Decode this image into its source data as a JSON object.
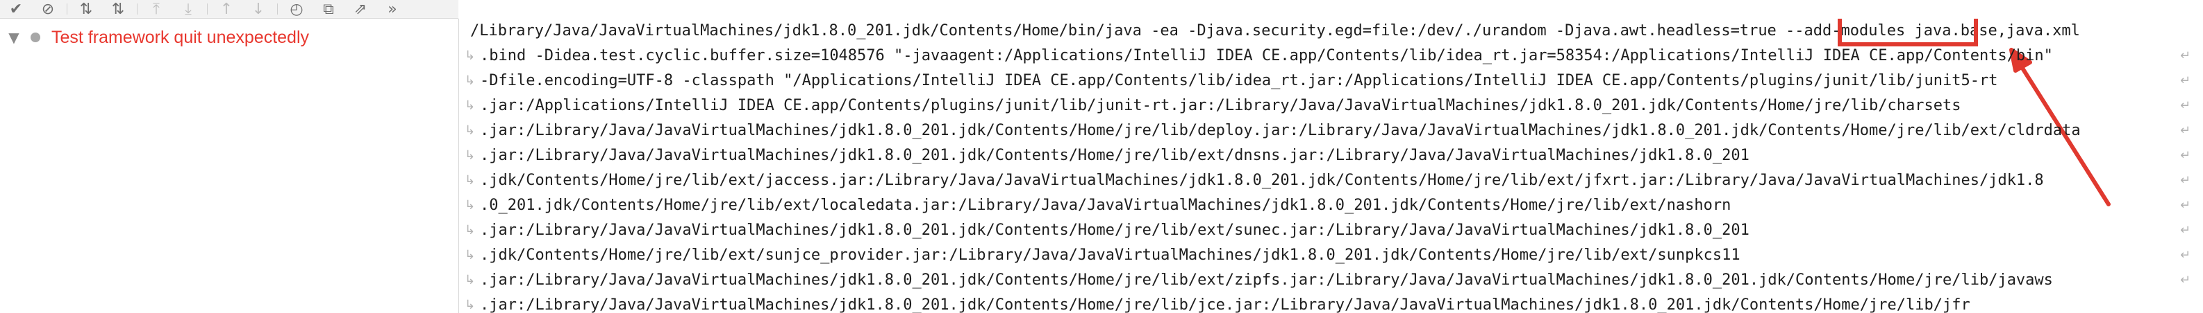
{
  "toolbar": {
    "buttons": [
      {
        "name": "check-icon",
        "glyph": "✔"
      },
      {
        "name": "stop-circle-icon",
        "glyph": "⊘"
      },
      {
        "name": "sort-alpha-icon",
        "glyph": "⇅"
      },
      {
        "name": "sort-duration-icon",
        "glyph": "⇅"
      },
      {
        "name": "import-icon",
        "glyph": "⤒"
      },
      {
        "name": "export-icon",
        "glyph": "⤓"
      },
      {
        "name": "up-arrow-icon",
        "glyph": "↑"
      },
      {
        "name": "down-arrow-icon",
        "glyph": "↓"
      },
      {
        "name": "history-icon",
        "glyph": "◴"
      },
      {
        "name": "open-tab-icon",
        "glyph": "⧉"
      },
      {
        "name": "external-link-icon",
        "glyph": "⇗"
      },
      {
        "name": "more-icon",
        "glyph": "»"
      }
    ]
  },
  "test_tree": {
    "expand_glyph": "▼",
    "item_label": "Test framework quit unexpectedly",
    "status_color": "#e8372e"
  },
  "console": {
    "lines": [
      "/Library/Java/JavaVirtualMachines/jdk1.8.0_201.jdk/Contents/Home/bin/java -ea -Djava.security.egd=file:/dev/./urandom -Djava.awt.headless=true --add-modules java.base,java.xml",
      ".bind -Didea.test.cyclic.buffer.size=1048576 \"-javaagent:/Applications/IntelliJ IDEA CE.app/Contents/lib/idea_rt.jar=58354:/Applications/IntelliJ IDEA CE.app/Contents/bin\"",
      "-Dfile.encoding=UTF-8 -classpath \"/Applications/IntelliJ IDEA CE.app/Contents/lib/idea_rt.jar:/Applications/IntelliJ IDEA CE.app/Contents/plugins/junit/lib/junit5-rt",
      ".jar:/Applications/IntelliJ IDEA CE.app/Contents/plugins/junit/lib/junit-rt.jar:/Library/Java/JavaVirtualMachines/jdk1.8.0_201.jdk/Contents/Home/jre/lib/charsets",
      ".jar:/Library/Java/JavaVirtualMachines/jdk1.8.0_201.jdk/Contents/Home/jre/lib/deploy.jar:/Library/Java/JavaVirtualMachines/jdk1.8.0_201.jdk/Contents/Home/jre/lib/ext/cldrdata",
      ".jar:/Library/Java/JavaVirtualMachines/jdk1.8.0_201.jdk/Contents/Home/jre/lib/ext/dnsns.jar:/Library/Java/JavaVirtualMachines/jdk1.8.0_201",
      ".jdk/Contents/Home/jre/lib/ext/jaccess.jar:/Library/Java/JavaVirtualMachines/jdk1.8.0_201.jdk/Contents/Home/jre/lib/ext/jfxrt.jar:/Library/Java/JavaVirtualMachines/jdk1.8",
      ".0_201.jdk/Contents/Home/jre/lib/ext/localedata.jar:/Library/Java/JavaVirtualMachines/jdk1.8.0_201.jdk/Contents/Home/jre/lib/ext/nashorn",
      ".jar:/Library/Java/JavaVirtualMachines/jdk1.8.0_201.jdk/Contents/Home/jre/lib/ext/sunec.jar:/Library/Java/JavaVirtualMachines/jdk1.8.0_201",
      ".jdk/Contents/Home/jre/lib/ext/sunjce_provider.jar:/Library/Java/JavaVirtualMachines/jdk1.8.0_201.jdk/Contents/Home/jre/lib/ext/sunpkcs11",
      ".jar:/Library/Java/JavaVirtualMachines/jdk1.8.0_201.jdk/Contents/Home/jre/lib/ext/zipfs.jar:/Library/Java/JavaVirtualMachines/jdk1.8.0_201.jdk/Contents/Home/jre/lib/javaws",
      ".jar:/Library/Java/JavaVirtualMachines/jdk1.8.0_201.jdk/Contents/Home/jre/lib/jce.jar:/Library/Java/JavaVirtualMachines/jdk1.8.0_201.jdk/Contents/Home/jre/lib/jfr"
    ],
    "highlighted_text": "--add-modules",
    "annotation_color": "#e0392f"
  }
}
